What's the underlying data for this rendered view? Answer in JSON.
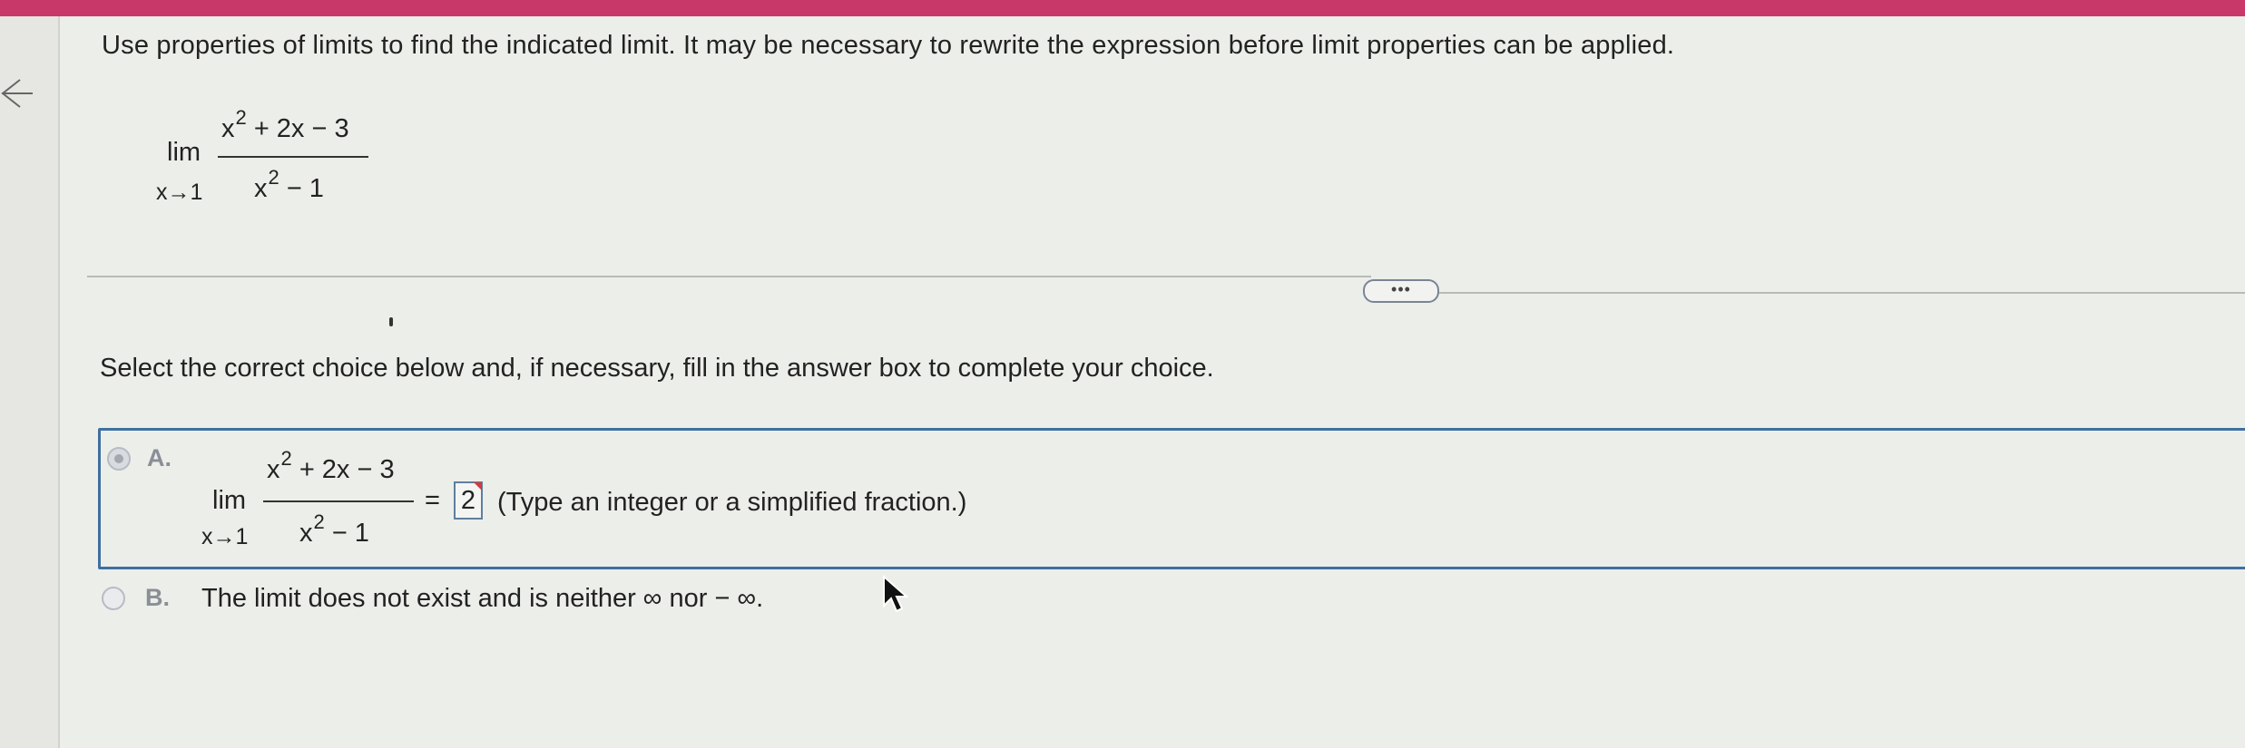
{
  "question": {
    "text": "Use properties of limits to find the indicated limit. It may be necessary to rewrite the expression before limit properties can be applied.",
    "limit": {
      "lim": "lim",
      "approach": "x→1",
      "numerator_base": "x",
      "numerator_exp": "2",
      "numerator_rest": "+ 2x − 3",
      "denominator_base": "x",
      "denominator_exp": "2",
      "denominator_rest": "− 1"
    }
  },
  "more_button": {
    "label": "•••"
  },
  "instruction": "Select the correct choice below and, if necessary, fill in the answer box to complete your choice.",
  "choices": {
    "a": {
      "letter": "A.",
      "selected": true,
      "lim": "lim",
      "approach": "x→1",
      "numerator_base": "x",
      "numerator_exp": "2",
      "numerator_rest": "+ 2x − 3",
      "denominator_base": "x",
      "denominator_exp": "2",
      "denominator_rest": "− 1",
      "equals": "=",
      "answer_value": "2",
      "hint": "(Type an integer or a simplified fraction.)"
    },
    "b": {
      "letter": "B.",
      "selected": false,
      "text": "The limit does not exist and is neither ∞ nor − ∞."
    }
  },
  "icons": {
    "back": "arrow-left-icon",
    "cursor": "mouse-pointer-icon"
  },
  "colors": {
    "topbar": "#c8396a",
    "selected_border": "#3f6fa0"
  }
}
